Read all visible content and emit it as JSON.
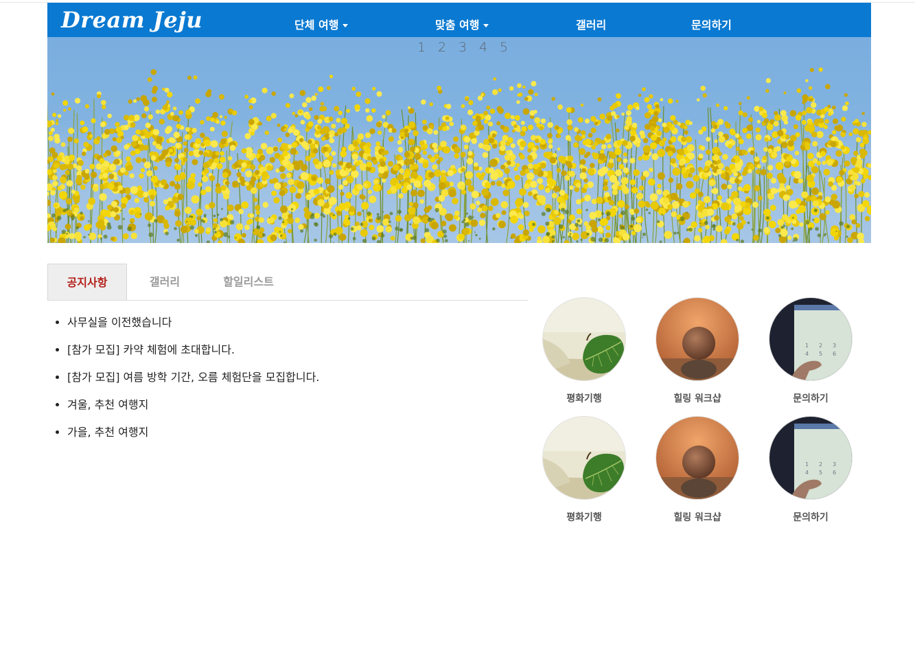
{
  "header": {
    "logo": "Dream Jeju",
    "nav": [
      {
        "label": "단체 여행",
        "has_dropdown": true
      },
      {
        "label": "맞춤 여행",
        "has_dropdown": true
      },
      {
        "label": "갤러리",
        "has_dropdown": false
      },
      {
        "label": "문의하기",
        "has_dropdown": false
      }
    ],
    "brand_color": "#0a79d1"
  },
  "slider": {
    "pages": [
      "1",
      "2",
      "3",
      "4",
      "5"
    ],
    "image": "yellow-canola-flowers-blue-sky"
  },
  "tabs": [
    {
      "label": "공지사항",
      "active": true
    },
    {
      "label": "갤러리",
      "active": false
    },
    {
      "label": "할일리스트",
      "active": false
    }
  ],
  "notices": [
    "사무실을 이전했습니다",
    "[참가 모집] 카약 체험에 초대합니다.",
    "[참가 모집] 여름 방학 기간, 오름 체험단을 모집합니다.",
    "겨울, 추천 여행지",
    "가을, 추천 여행지"
  ],
  "gallery": [
    {
      "label": "평화기행",
      "image": "leaf-on-sand"
    },
    {
      "label": "힐링 워크샵",
      "image": "balanced-stones"
    },
    {
      "label": "문의하기",
      "image": "phone-dialpad"
    },
    {
      "label": "평화기행",
      "image": "leaf-on-sand"
    },
    {
      "label": "힐링 워크샵",
      "image": "balanced-stones"
    },
    {
      "label": "문의하기",
      "image": "phone-dialpad"
    }
  ],
  "colors": {
    "active_tab_text": "#b4201a",
    "flower_yellow": "#f2d60a",
    "sky": "#7aaedf"
  }
}
